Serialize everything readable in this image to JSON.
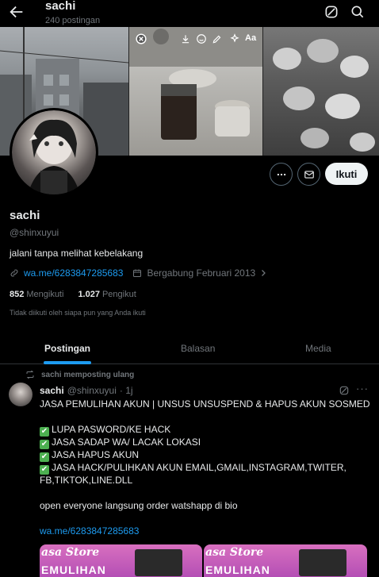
{
  "header": {
    "title": "sachi",
    "post_count": "240 postingan"
  },
  "banner": {
    "story_text_label": "Aa"
  },
  "actions": {
    "follow_label": "Ikuti"
  },
  "profile": {
    "name": "sachi",
    "handle": "@shinxuyui",
    "bio": "jalani tanpa melihat kebelakang",
    "link": "wa.me/6283847285683",
    "joined": "Bergabung Februari 2013",
    "following_count": "852",
    "following_label": "Mengikuti",
    "followers_count": "1.027",
    "followers_label": "Pengikut",
    "not_followed_note": "Tidak diikuti oleh siapa pun yang Anda ikuti"
  },
  "tabs": [
    {
      "label": "Postingan",
      "active": true
    },
    {
      "label": "Balasan",
      "active": false
    },
    {
      "label": "Media",
      "active": false
    }
  ],
  "post": {
    "repost_label": "sachi memposting ulang",
    "author_name": "sachi",
    "author_handle": "@shinxuyui",
    "time": "· 1j",
    "line1": "JASA PEMULIHAN AKUN | UNSUS UNSUSPEND & HAPUS AKUN SOSMED",
    "item1": "LUPA PASWORD/KE HACK",
    "item2": "JASA SADAP WA/ LACAK LOKASI",
    "item3": "JASA HAPUS AKUN",
    "item4a": "JASA HACK/PULIHKAN AKUN EMAIL,GMAIL,INSTAGRAM,TWITER,",
    "item4b": "FB,TIKTOK,LINE.DLL",
    "line_order": "open everyone langsung order watshapp di bio",
    "link": "wa.me/6283847285683",
    "image_text_1": "asa Store",
    "image_text_2": "EMULIHAN",
    "image_text_3": "asa Store",
    "image_text_4": "EMULIHAN"
  },
  "colors": {
    "accent": "#1d9bf0",
    "background": "#000000",
    "muted": "#71767b"
  },
  "icons": [
    "back-arrow-icon",
    "grok-icon",
    "search-icon",
    "more-icon",
    "mail-icon",
    "link-icon",
    "calendar-icon",
    "chevron-right-icon",
    "repost-icon",
    "check-icon"
  ]
}
